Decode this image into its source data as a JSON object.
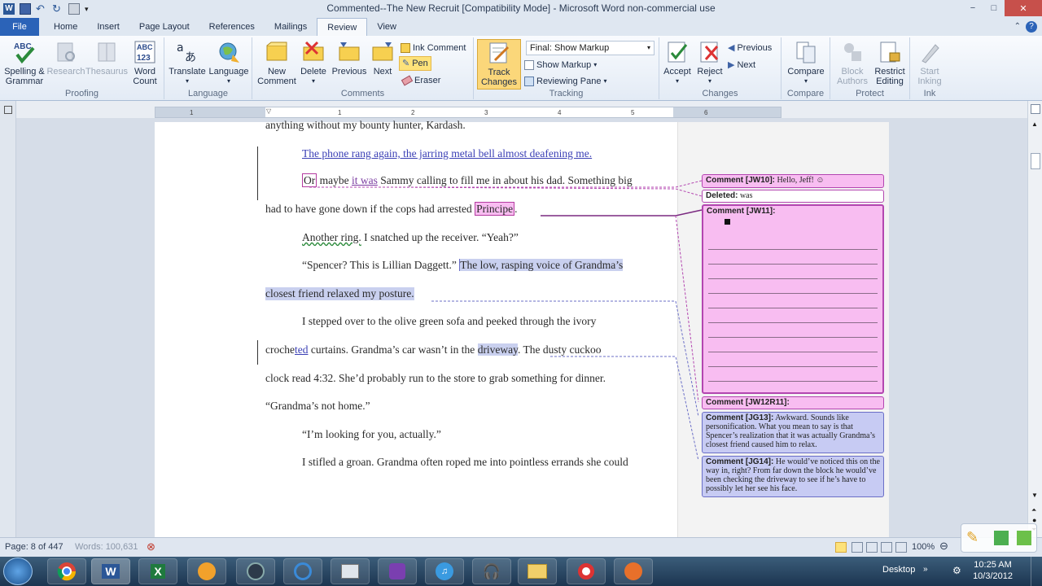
{
  "window": {
    "title": "Commented--The New Recruit [Compatibility Mode] - Microsoft Word non-commercial use",
    "controls": {
      "minimize": "−",
      "maximize": "□",
      "close": "✕"
    }
  },
  "tabs": [
    "File",
    "Home",
    "Insert",
    "Page Layout",
    "References",
    "Mailings",
    "Review",
    "View"
  ],
  "active_tab": "Review",
  "ribbon": {
    "proofing": {
      "spelling": "Spelling &",
      "spelling2": "Grammar",
      "research": "Research",
      "thesaurus": "Thesaurus",
      "word_count": "Word",
      "word_count2": "Count",
      "name": "Proofing"
    },
    "language": {
      "translate": "Translate",
      "language": "Language",
      "name": "Language"
    },
    "comments": {
      "new": "New",
      "new2": "Comment",
      "delete": "Delete",
      "previous": "Previous",
      "next": "Next",
      "ink_comment": "Ink Comment",
      "pen": "Pen",
      "eraser": "Eraser",
      "name": "Comments"
    },
    "tracking": {
      "track": "Track",
      "track2": "Changes",
      "final": "Final: Show Markup",
      "show_markup": "Show Markup",
      "reviewing_pane": "Reviewing Pane",
      "name": "Tracking"
    },
    "changes": {
      "accept": "Accept",
      "reject": "Reject",
      "previous": "Previous",
      "next": "Next",
      "name": "Changes"
    },
    "compare": {
      "compare": "Compare",
      "name": "Compare"
    },
    "protect": {
      "block": "Block",
      "block2": "Authors",
      "restrict": "Restrict",
      "restrict2": "Editing",
      "name": "Protect"
    },
    "ink": {
      "start": "Start",
      "start2": "Inking",
      "name": "Ink"
    }
  },
  "ruler_numbers": [
    "1",
    "1",
    "2",
    "3",
    "4",
    "5",
    "6"
  ],
  "document": {
    "line0": "anything without my bounty hunter, Kardash.",
    "line1": "The phone rang again, the jarring metal bell almost deafening me.",
    "line2a": "Or",
    "line2b": " maybe ",
    "line2c": "it was",
    "line2d": " Sammy calling to fill me in about his dad. Something big",
    "line3a": "had to have gone down if the cops had arrested ",
    "line3b": "Principe",
    "line3c": ".",
    "line4a": "Another ring.",
    "line4b": " I snatched up the receiver.  “Yeah?”",
    "line5a": "“Spencer? This is Lillian Daggett.” ",
    "line5b": "The low, rasping voice of Grandma’s",
    "line6": "closest friend relaxed my posture.",
    "line7": "I stepped over to the olive green sofa and peeked through the ivory",
    "line8a": "croche",
    "line8b": "ted",
    "line8c": " curtains. Grandma’s car wasn’t in the ",
    "line8d": "driveway",
    "line8e": ". The dusty cuckoo",
    "line9": "clock read 4:32.  She’d probably run to the store to grab something for dinner.",
    "line10": "“Grandma’s not home.”",
    "line11": "“I’m looking for you, actually.”",
    "line12": "I stifled a groan.  Grandma often roped me into pointless errands she could"
  },
  "comments": {
    "c1_label": "Comment [JW10]:",
    "c1_text": " Hello, Jeff! ☺",
    "c2_label": "Deleted:",
    "c2_text": " was",
    "c3_label": "Comment [JW11]:",
    "c4_label": "Comment [JW12R11]:",
    "c5_label": "Comment [JG13]:",
    "c5_text": " Awkward. Sounds like personification. What you mean to say is that Spencer’s realization that it was actually Grandma’s closest friend caused him to relax.",
    "c6_label": "Comment [JG14]:",
    "c6_text": " He would’ve noticed this on the way in, right? From far down the block he would’ve been checking the driveway to see if he’s have to possibly let her see his face."
  },
  "status": {
    "page": "Page: 8 of 447",
    "words": "Words: 100,631",
    "zoom": "100%"
  },
  "taskbar": {
    "desktop": "Desktop",
    "time": "10:25 AM",
    "date": "10/3/2012"
  }
}
